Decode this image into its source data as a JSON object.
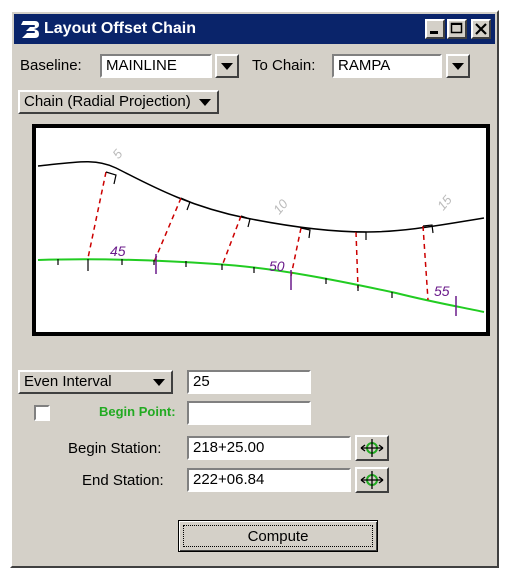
{
  "window": {
    "title": "Layout Offset Chain"
  },
  "baseline": {
    "label": "Baseline:",
    "value": "MAINLINE"
  },
  "to_chain": {
    "label": "To Chain:",
    "value": "RAMPA"
  },
  "projection_method": {
    "value": "Chain (Radial Projection)"
  },
  "plot": {
    "baseline_stations": [
      "5",
      "10",
      "15"
    ],
    "offset_chain_stations": [
      "45",
      "50",
      "55"
    ],
    "colors": {
      "baseline": "#000000",
      "offset_chain": "#22cc22",
      "projection": "#cc0000",
      "station_text": "#6a1a8a"
    }
  },
  "interval": {
    "mode": "Even Interval",
    "value": "25"
  },
  "begin_point": {
    "label": "Begin Point:",
    "checked": false,
    "value": ""
  },
  "begin_station": {
    "label": "Begin Station:",
    "value": "218+25.00"
  },
  "end_station": {
    "label": "End Station:",
    "value": "222+06.84"
  },
  "compute_label": "Compute",
  "icons": [
    "minimize-icon",
    "maximize-icon",
    "close-icon",
    "app-icon",
    "locate-target-icon",
    "chevron-down-icon"
  ]
}
